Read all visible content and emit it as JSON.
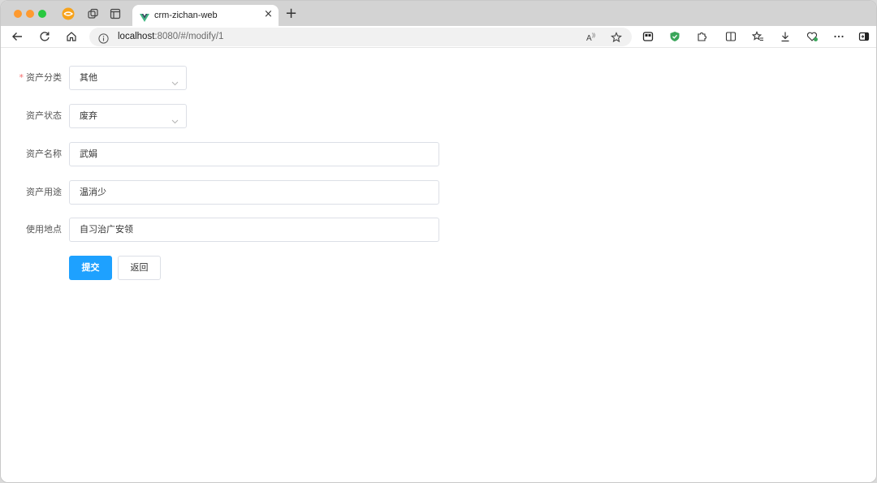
{
  "browser": {
    "tab_title": "crm-zichan-web",
    "url_host": "localhost",
    "url_rest": ":8080/#/modify/1",
    "icons": [
      "wallet-icon",
      "copy-tabs-icon",
      "sidebar-icon",
      "vue-favicon",
      "close-icon",
      "plus-icon",
      "back-icon",
      "reload-icon",
      "home-icon",
      "info-icon",
      "read-aloud-icon",
      "star-icon",
      "collections-icon",
      "shield-icon",
      "extensions-icon",
      "split-screen-icon",
      "favorites-icon",
      "download-icon",
      "heart-icon",
      "more-icon",
      "sidebar-toggle-icon"
    ]
  },
  "form": {
    "required_mark": "*",
    "category": {
      "label": "资产分类",
      "value": "其他"
    },
    "status": {
      "label": "资产状态",
      "value": "废弃"
    },
    "name": {
      "label": "资产名称",
      "value": "武娟"
    },
    "usage": {
      "label": "资产用途",
      "value": "温消少"
    },
    "location": {
      "label": "使用地点",
      "value": "自习治广安领"
    },
    "submit_label": "提交",
    "back_label": "返回"
  },
  "colors": {
    "primary": "#1ea1ff",
    "required": "#f56c6c",
    "border": "#dcdfe6"
  }
}
